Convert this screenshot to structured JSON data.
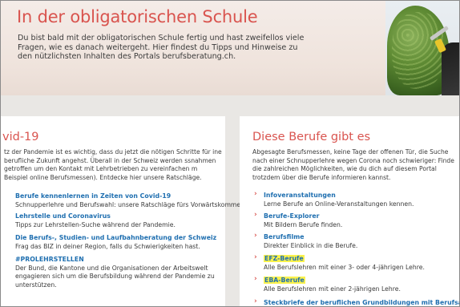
{
  "hero": {
    "title": "In der obligatorischen Schule",
    "text": "Du bist bald mit der obligatorischen Schule fertig und hast zweifellos viele Fragen, wie es danach weitergeht. Hier findest du Tipps und Hinweise zu den nützlichsten Inhalten des Portals berufsberatung.ch."
  },
  "left": {
    "title": "vid-19",
    "intro": "tz der Pandemie ist es wichtig, dass du jetzt die nötigen Schritte für ine berufliche Zukunft angehst. Überall in der Schweiz werden ssnahmen getroffen um den Kontakt mit Lehrbetrieben zu vereinfachen m Beispiel online Berufsmessen). Entdecke hier unsere Ratschläge.",
    "links": [
      {
        "title": "Berufe kennenlernen in Zeiten von Covid-19",
        "desc": "Schnupperlehre und Berufswahl: unsere Ratschläge fürs Vorwärtskommen!"
      },
      {
        "title": "Lehrstelle und Coronavirus",
        "desc": "Tipps zur Lehrstellen-Suche während der Pandemie."
      },
      {
        "title": "Die Berufs-, Studien- und Laufbahnberatung der Schweiz",
        "desc": "Frag das BIZ in deiner Region, falls du Schwierigkeiten hast."
      },
      {
        "title": "#PROLEHRSTELLEN",
        "desc": "Der Bund, die Kantone und die Organisationen der Arbeitswelt engagieren sich um die Berufsbildung während der Pandemie zu unterstützen."
      }
    ]
  },
  "right": {
    "title": "Diese Berufe gibt es",
    "intro": "Abgesagte Berufsmessen, keine Tage der offenen Tür, die Suche nach einer Schnupperlehre wegen Corona noch schwieriger: Finde die zahlreichen Möglichkeiten, wie du dich auf diesem Portal trotzdem über die Berufe informieren kannst.",
    "arrow": "›",
    "links": [
      {
        "title": "Infoveranstaltungen",
        "desc": "Lerne Berufe an Online-Veranstaltungen kennen."
      },
      {
        "title": "Berufe-Explorer",
        "desc": "Mit Bildern Berufe finden."
      },
      {
        "title": "Berufsfilme",
        "desc": "Direkter Einblick in die Berufe."
      },
      {
        "title": "EFZ-Berufe",
        "desc": "Alle Berufslehren mit einer 3- oder 4-jährigen Lehre."
      },
      {
        "title": "EBA-Berufe",
        "desc": "Alle Berufslehren mit einer 2-jährigen Lehre."
      },
      {
        "title": "Steckbriefe der beruflichen Grundbildungen mit Berufsattest",
        "desc": ""
      }
    ]
  },
  "colors": {
    "accent_red": "#d9544f",
    "link_blue": "#1f6fb0",
    "highlight": "#fbf24c"
  }
}
